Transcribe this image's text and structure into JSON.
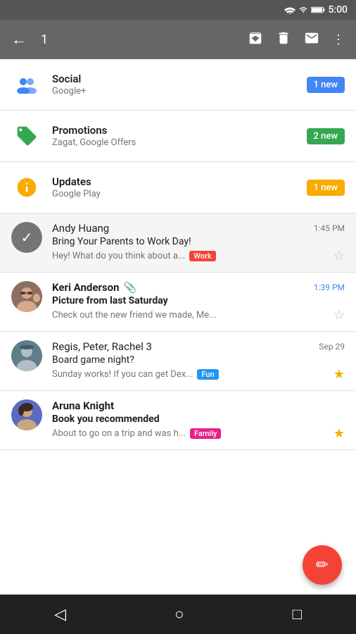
{
  "statusBar": {
    "time": "5:00"
  },
  "toolbar": {
    "count": "1",
    "backLabel": "←"
  },
  "categories": [
    {
      "id": "social",
      "name": "Social",
      "sub": "Google+",
      "badge": "1 new",
      "badgeColor": "blue",
      "iconType": "social"
    },
    {
      "id": "promotions",
      "name": "Promotions",
      "sub": "Zagat, Google Offers",
      "badge": "2 new",
      "badgeColor": "green",
      "iconType": "promo"
    },
    {
      "id": "updates",
      "name": "Updates",
      "sub": "Google Play",
      "badge": "1 new",
      "badgeColor": "yellow",
      "iconType": "updates"
    }
  ],
  "emails": [
    {
      "id": "andy",
      "sender": "Andy Huang",
      "time": "1:45 PM",
      "timeBlue": false,
      "subject": "Bring Your Parents to Work Day!",
      "preview": "Hey! What do you think about a...",
      "tag": "Work",
      "tagClass": "tag-work",
      "starred": false,
      "selected": true,
      "hasClip": false,
      "avatarType": "check"
    },
    {
      "id": "keri",
      "sender": "Keri Anderson",
      "time": "1:39 PM",
      "timeBlue": true,
      "subject": "Picture from last Saturday",
      "preview": "Check out the new friend we made, Me...",
      "tag": null,
      "starred": false,
      "selected": false,
      "hasClip": true,
      "avatarType": "keri",
      "unread": true
    },
    {
      "id": "regis",
      "sender": "Regis, Peter, Rachel  3",
      "time": "Sep 29",
      "timeBlue": false,
      "subject": "Board game night?",
      "preview": "Sunday works! If you can get Dex...",
      "tag": "Fun",
      "tagClass": "tag-fun",
      "starred": true,
      "selected": false,
      "hasClip": false,
      "avatarType": "regis"
    },
    {
      "id": "aruna",
      "sender": "Aruna Knight",
      "time": "",
      "timeBlue": false,
      "subject": "Book you recommended",
      "preview": "About to go on a trip and was h...",
      "tag": "Family",
      "tagClass": "tag-family",
      "starred": true,
      "selected": false,
      "hasClip": false,
      "avatarType": "aruna",
      "unread": true
    }
  ],
  "fab": {
    "label": "✏"
  },
  "bottomNav": {
    "back": "◁",
    "home": "○",
    "recents": "□"
  }
}
